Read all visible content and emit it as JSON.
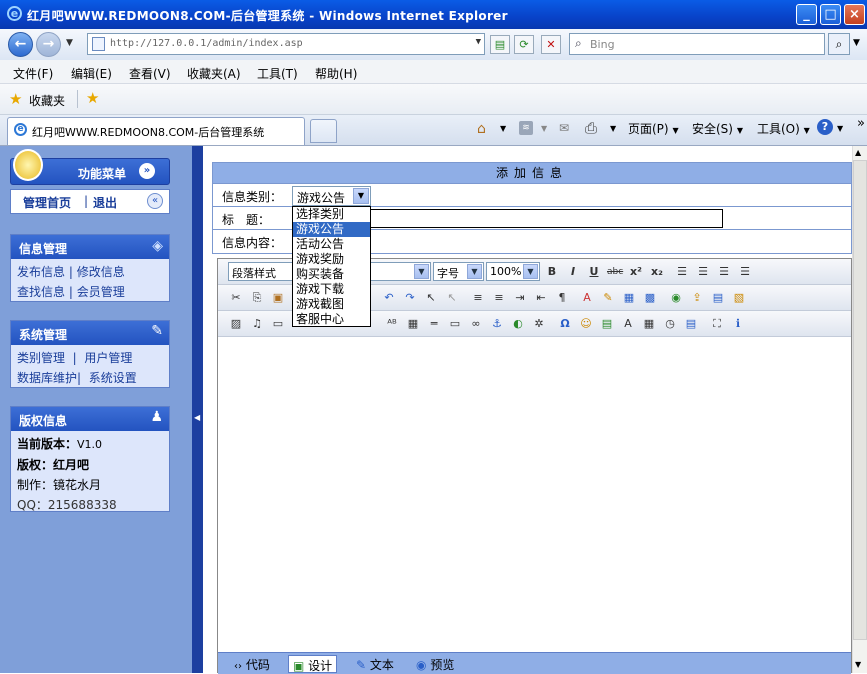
{
  "window": {
    "title": "红月吧WWW.REDMOON8.COM-后台管理系统 - Windows Internet Explorer"
  },
  "address": {
    "url": "http://127.0.0.1/admin/index.asp",
    "search_placeholder": "Bing"
  },
  "menu": [
    "文件(F)",
    "编辑(E)",
    "查看(V)",
    "收藏夹(A)",
    "工具(T)",
    "帮助(H)"
  ],
  "favorites": {
    "label": "收藏夹"
  },
  "tab": {
    "title": "红月吧WWW.REDMOON8.COM-后台管理系统"
  },
  "command_bar": {
    "page": "页面(P)",
    "safety": "安全(S)",
    "tools": "工具(O)"
  },
  "sidebar": {
    "header": "功能菜单",
    "home": "管理首页",
    "sep": "|",
    "logout": "退出",
    "info": {
      "title": "信息管理",
      "items": [
        "发布信息",
        "修改信息",
        "查找信息",
        "会员管理"
      ]
    },
    "system": {
      "title": "系统管理",
      "items": [
        "类别管理",
        "用户管理",
        "数据库维护",
        "系统设置"
      ]
    },
    "copyright": {
      "title": "版权信息",
      "version_label": "当前版本：",
      "version": "V1.0",
      "owner": "版权：红月吧",
      "author": "制作：镜花水月",
      "qq": "QQ：215688338"
    }
  },
  "form": {
    "title": "添加信息",
    "category_label": "信息类别：",
    "category_selected": "游戏公告",
    "category_options": [
      "选择类别",
      "游戏公告",
      "活动公告",
      "游戏奖励",
      "购买装备",
      "游戏下载",
      "游戏截图",
      "客服中心"
    ],
    "title_label": "标　题：",
    "content_label": "信息内容："
  },
  "editor": {
    "paragraph_style": "段落样式",
    "font_size": "字号",
    "zoom": "100%",
    "modes": [
      "代码",
      "设计",
      "文本",
      "预览"
    ]
  }
}
